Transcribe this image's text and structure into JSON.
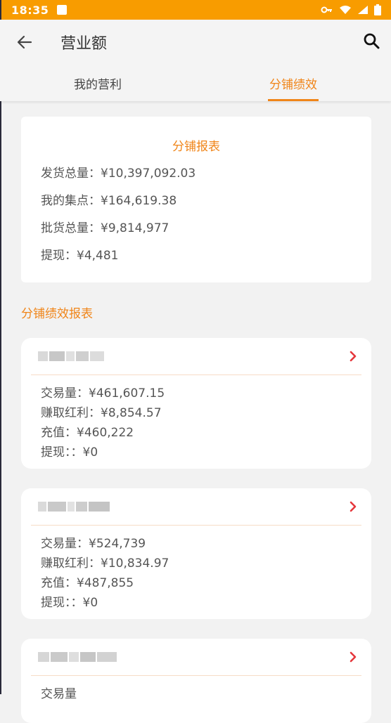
{
  "status_bar": {
    "time": "18:35"
  },
  "header": {
    "title": "营业额"
  },
  "tabs": [
    {
      "label": "我的营利",
      "active": false
    },
    {
      "label": "分铺绩效",
      "active": true
    }
  ],
  "summary": {
    "title": "分铺报表",
    "lines": [
      "发货总量：¥10,397,092.03",
      "我的集点：¥164,619.38",
      "批货总量：¥9,814,977",
      "提现：¥4,481"
    ]
  },
  "section_title": "分铺绩效报表",
  "stores": [
    {
      "lines": [
        "交易量：¥461,607.15",
        "赚取红利：¥8,854.57",
        "充值：¥460,222",
        "提现：：¥0"
      ]
    },
    {
      "lines": [
        "交易量：¥524,739",
        "赚取红利：¥10,834.97",
        "充值：¥487,855",
        "提现：：¥0"
      ]
    },
    {
      "lines": [
        "交易量"
      ]
    }
  ],
  "colors": {
    "accent": "#f08519",
    "status_bar": "#f89c00",
    "chevron": "#e5373c"
  },
  "icons": {
    "back": "arrow-left",
    "search": "magnifier",
    "chevron": "chevron-right"
  }
}
